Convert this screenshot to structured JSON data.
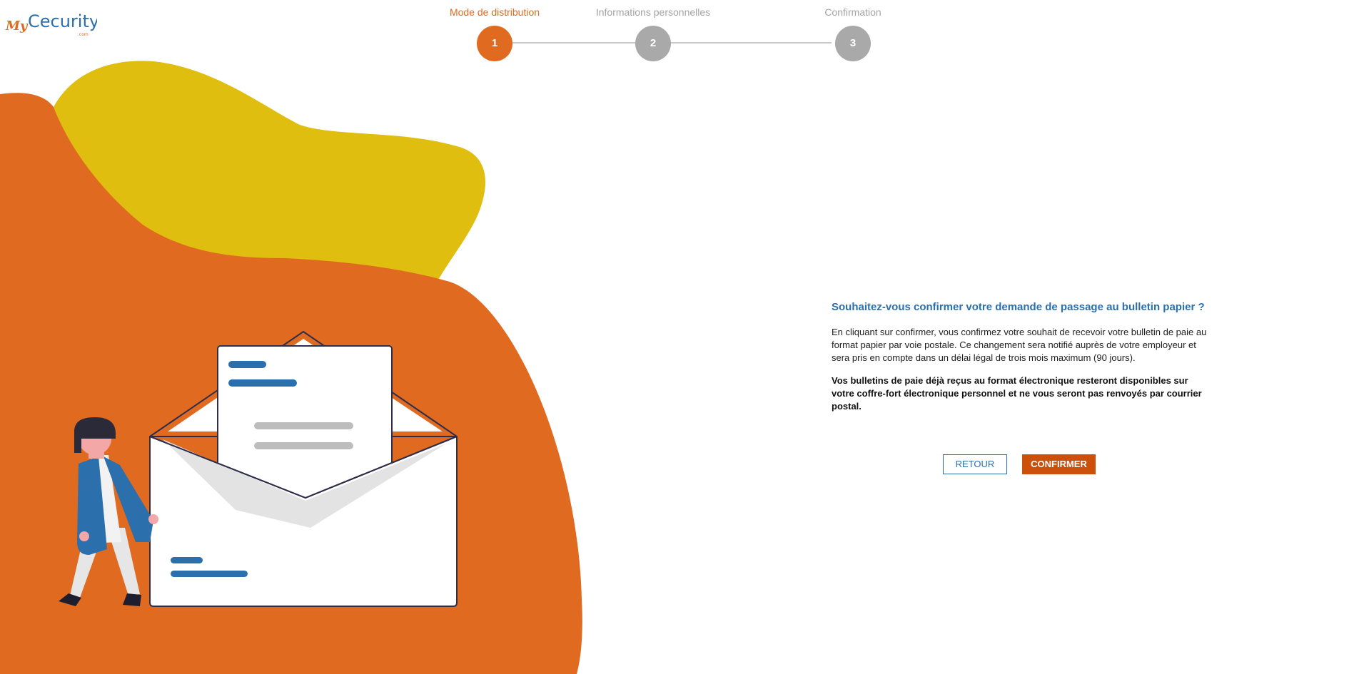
{
  "logo": {
    "prefix": "My",
    "name": "Cecurity",
    "suffix": ".com"
  },
  "steps": [
    {
      "number": "1",
      "label": "Mode de distribution",
      "active": true
    },
    {
      "number": "2",
      "label": "Informations personnelles",
      "active": false
    },
    {
      "number": "3",
      "label": "Confirmation",
      "active": false
    }
  ],
  "content": {
    "question": "Souhaitez-vous confirmer votre demande de passage au bulletin papier ?",
    "paragraph1": "En cliquant sur confirmer, vous confirmez votre souhait de recevoir votre bulletin de paie au format papier par voie postale. Ce changement sera notifié auprès de votre employeur et sera pris en compte dans un délai légal de trois mois maximum (90 jours).",
    "paragraph2": "Vos bulletins de paie déjà reçus au format électronique resteront disponibles sur votre coffre-fort électronique personnel et ne vous seront pas renvoyés par courrier postal."
  },
  "buttons": {
    "back": "RETOUR",
    "confirm": "CONFIRMER"
  },
  "colors": {
    "orange": "#e06a20",
    "yellow": "#dfbe10",
    "blue": "#2b6fad",
    "gray": "#a9a9a9",
    "button_orange": "#cc4f0a"
  }
}
